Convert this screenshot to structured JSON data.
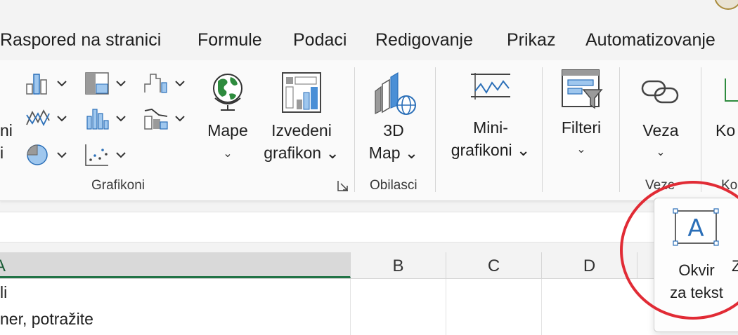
{
  "tabs": [
    {
      "label": "Raspored na stranici"
    },
    {
      "label": "Formule"
    },
    {
      "label": "Podaci"
    },
    {
      "label": "Redigovanje"
    },
    {
      "label": "Prikaz"
    },
    {
      "label": "Automatizovanje"
    }
  ],
  "ribbon": {
    "cut_label_1": "ni",
    "cut_label_2": "i",
    "maps": {
      "line1": "Mape",
      "caret": "⌄"
    },
    "pivot_chart": {
      "line1": "Izvedeni",
      "line2": "grafikon ⌄"
    },
    "map3d": {
      "line1": "3D",
      "line2": "Map ⌄"
    },
    "sparklines": {
      "line1": "Mini-",
      "line2": "grafikoni ⌄"
    },
    "filters": {
      "line1": "Filteri",
      "caret": "⌄"
    },
    "link": {
      "line1": "Veza",
      "caret": "⌄"
    },
    "comment_cut": "Ko",
    "groups": {
      "charts": "Grafikoni",
      "tours": "Obilasci",
      "links": "Veze",
      "comments_cut": "Ko"
    },
    "colors": {
      "accent_blue": "#4a8fd6",
      "gray": "#9a9a9a"
    }
  },
  "columns": {
    "a": "A",
    "b": "B",
    "c": "C",
    "d": "D"
  },
  "cells": {
    "row1": "li",
    "row2": "ner, potražite"
  },
  "popup": {
    "label_line1": "Okvir",
    "label_line2": "za tekst",
    "next_cut": "Z",
    "icon": "text-box-icon",
    "glyph": "A"
  },
  "annotation_color": "#e12b35"
}
